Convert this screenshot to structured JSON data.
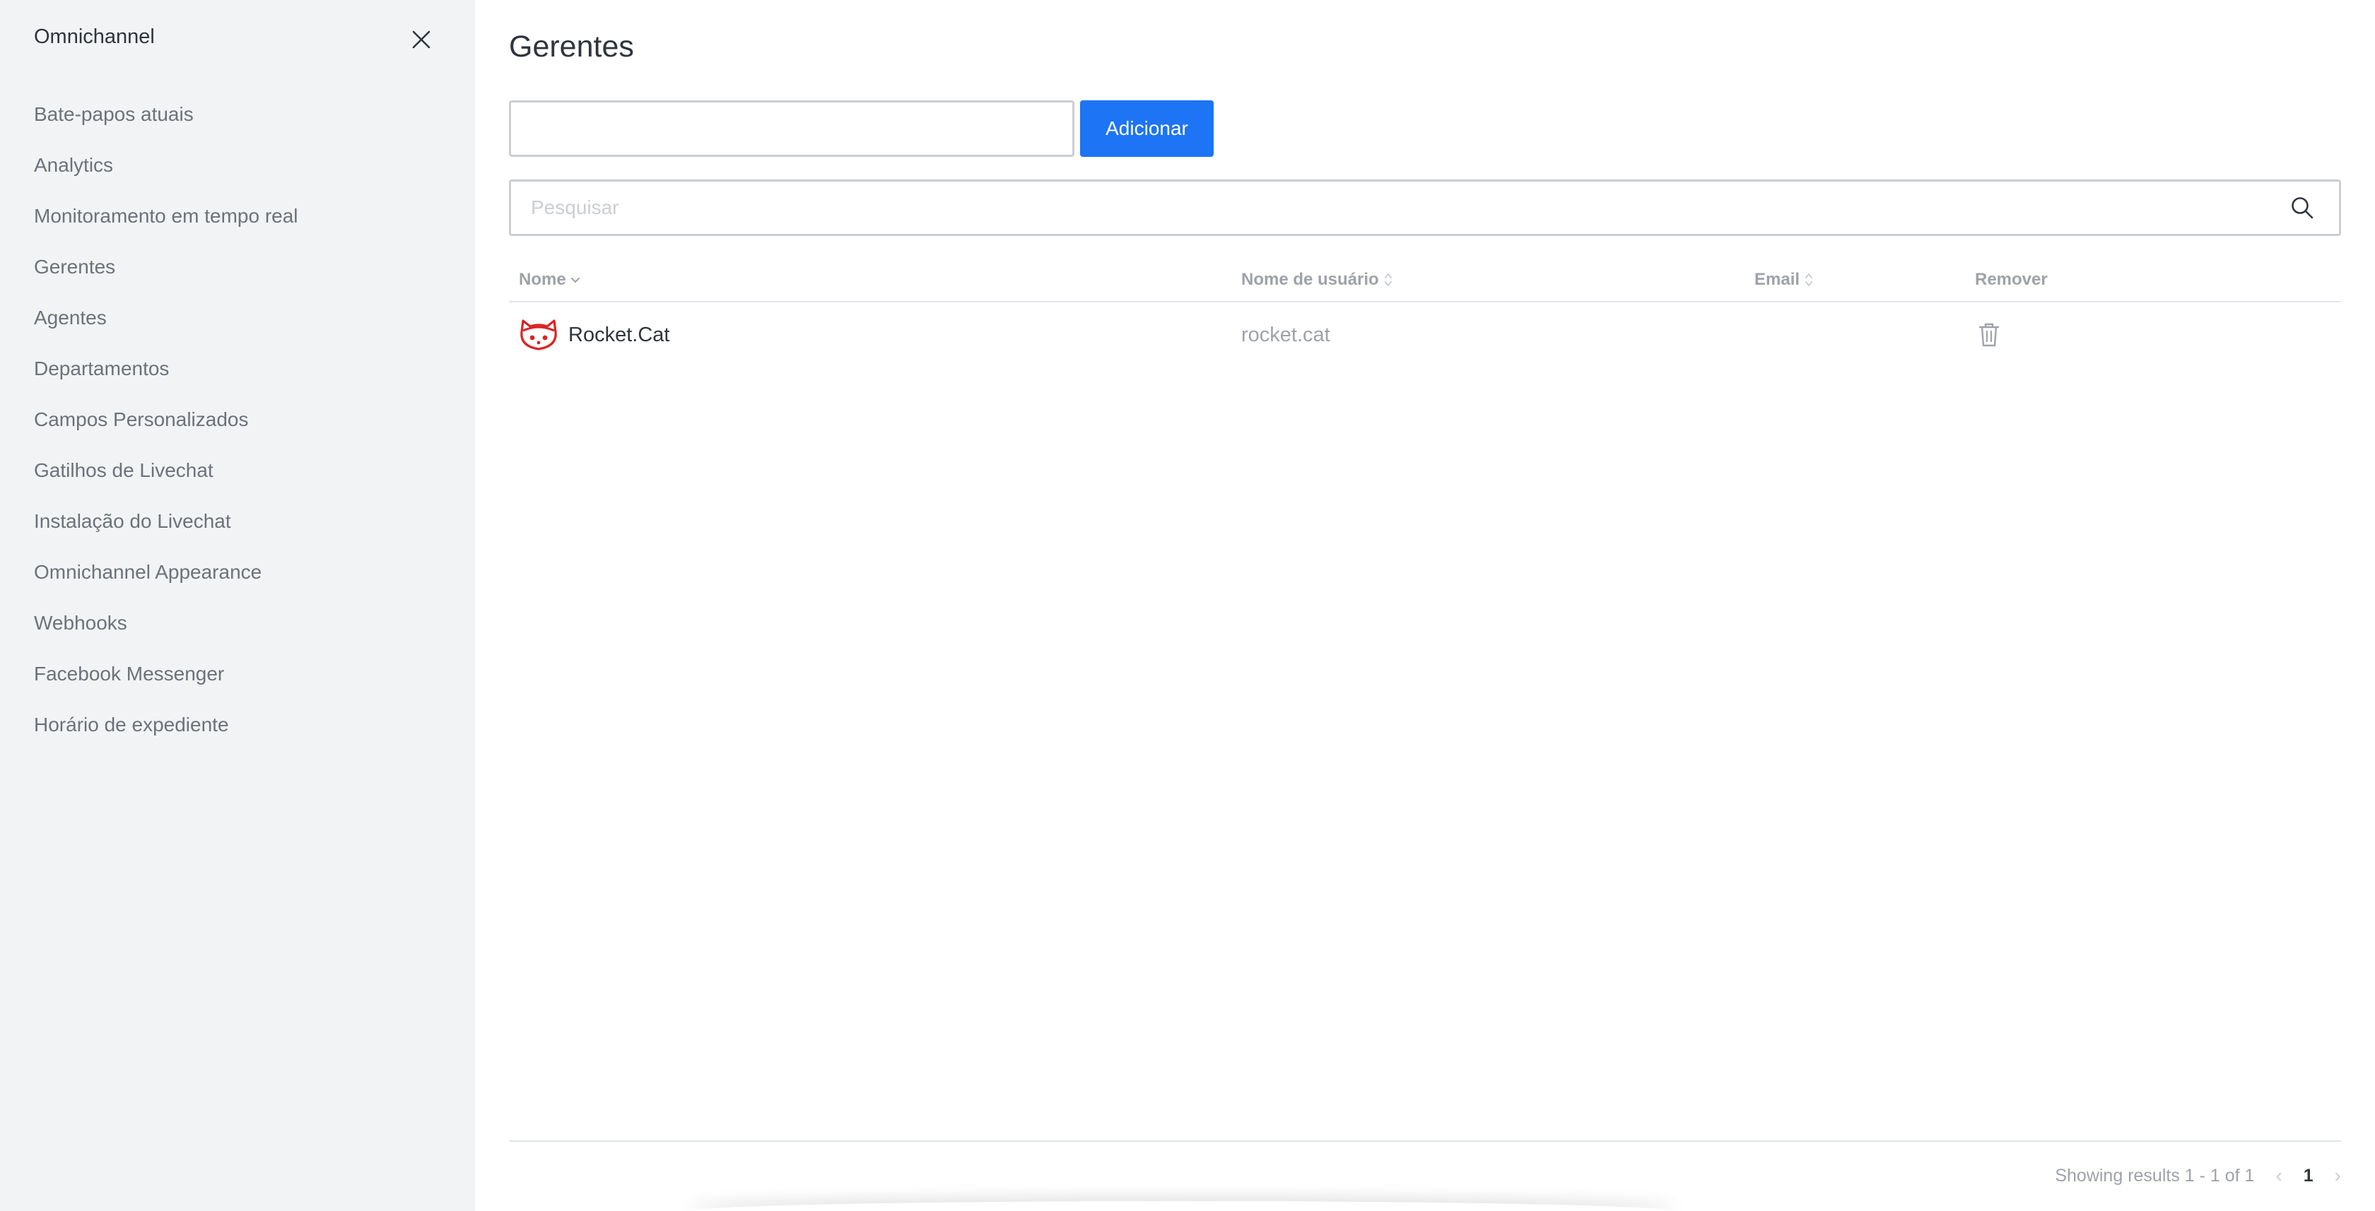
{
  "sidebar": {
    "title": "Omnichannel",
    "items": [
      {
        "label": "Bate-papos atuais"
      },
      {
        "label": "Analytics"
      },
      {
        "label": "Monitoramento em tempo real"
      },
      {
        "label": "Gerentes"
      },
      {
        "label": "Agentes"
      },
      {
        "label": "Departamentos"
      },
      {
        "label": "Campos Personalizados"
      },
      {
        "label": "Gatilhos de Livechat"
      },
      {
        "label": "Instalação do Livechat"
      },
      {
        "label": "Omnichannel Appearance"
      },
      {
        "label": "Webhooks"
      },
      {
        "label": "Facebook Messenger"
      },
      {
        "label": "Horário de expediente"
      }
    ]
  },
  "main": {
    "title": "Gerentes",
    "add_input": {
      "value": "",
      "placeholder": ""
    },
    "add_button_label": "Adicionar",
    "search": {
      "value": "",
      "placeholder": "Pesquisar"
    },
    "table": {
      "columns": [
        {
          "label": "Nome"
        },
        {
          "label": "Nome de usuário"
        },
        {
          "label": "Email"
        },
        {
          "label": "Remover"
        }
      ],
      "rows": [
        {
          "name": "Rocket.Cat",
          "username": "rocket.cat",
          "email": ""
        }
      ]
    },
    "pagination": {
      "results_text": "Showing results 1 - 1 of 1",
      "current_page": "1",
      "prev_arrow": "‹",
      "next_arrow": "›"
    }
  },
  "colors": {
    "primary": "#1d74f5",
    "sidebar_bg": "#f2f3f5",
    "avatar_red": "#db2323",
    "muted_text": "#9ea2a8"
  },
  "icons": {
    "close": "close-icon",
    "search": "search-icon",
    "sort": "sort-icon",
    "trash": "trash-icon",
    "avatar": "rocket-cat-avatar"
  }
}
